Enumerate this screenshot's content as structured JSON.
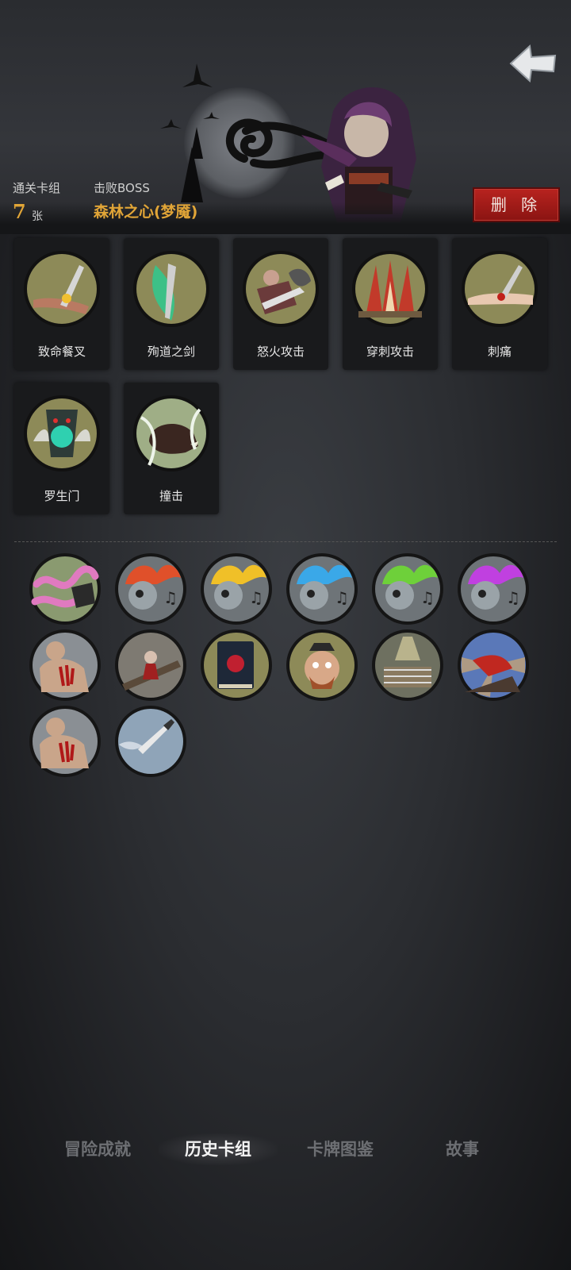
{
  "header": {
    "cleared_deck_label": "通关卡组",
    "card_count": "7",
    "card_unit": "张",
    "defeated_boss_label": "击败BOSS",
    "boss_name": "森林之心(梦魇)",
    "delete_label": "删 除"
  },
  "cards": [
    {
      "name": "致命餐叉",
      "icon": "fork-stab-icon"
    },
    {
      "name": "殉道之剑",
      "icon": "martyr-sword-icon"
    },
    {
      "name": "怒火攻击",
      "icon": "fury-attack-icon"
    },
    {
      "name": "穿刺攻击",
      "icon": "pierce-attack-icon"
    },
    {
      "name": "刺痛",
      "icon": "sting-icon"
    },
    {
      "name": "罗生门",
      "icon": "rashomon-icon"
    },
    {
      "name": "撞击",
      "icon": "boar-charge-icon"
    }
  ],
  "relics": [
    "tentacle-relic-icon",
    "red-fire-skull-icon",
    "yellow-fire-skull-icon",
    "blue-fire-skull-icon",
    "green-fire-skull-icon",
    "purple-fire-skull-icon",
    "bloody-brawler-icon",
    "girl-on-bridge-icon",
    "red-book-icon",
    "scared-pirate-icon",
    "boxing-ring-icon",
    "red-cape-hero-icon",
    "bloody-brawler-icon",
    "knife-sky-icon"
  ],
  "nav": {
    "tabs": [
      "冒险成就",
      "历史卡组",
      "卡牌图鉴",
      "故事"
    ],
    "active": "历史卡组"
  },
  "colors": {
    "accent_gold": "#e1a537",
    "delete_red": "#b8231f",
    "card_bg": "#191a1c",
    "disc_olive": "#8a8a5a"
  }
}
